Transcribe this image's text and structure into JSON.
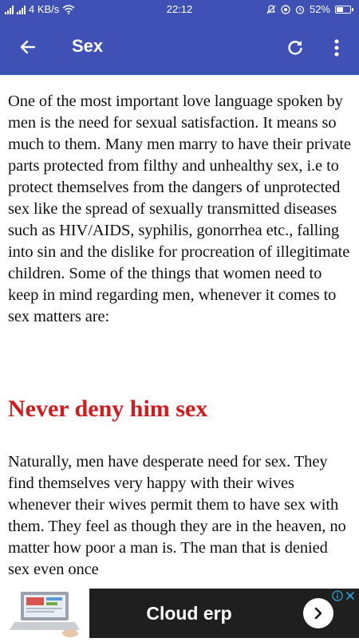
{
  "status_bar": {
    "network_speed": "4 KB/s",
    "time": "22:12",
    "battery_percent": "52%",
    "battery_level": 0.52
  },
  "app_bar": {
    "title": "Sex"
  },
  "article": {
    "paragraph1": "One of the most important love language spoken by men is the need for sexual satisfaction. It means so much to them. Many men marry to have their private parts protected from filthy and unhealthy sex, i.e to protect themselves from the dangers of unprotected sex like the spread of sexually transmitted diseases such as HIV/AIDS, syphilis, gonorrhea etc., falling into sin and the dislike for procreation of illegitimate children. Some of the things that women need to keep in mind regarding men, whenever it comes to sex matters are:",
    "heading": "Never deny him sex",
    "paragraph2": "Naturally, men have desperate need for sex. They find themselves very happy with their wives whenever their wives permit them to have sex with them. They feel as though they are in the heaven, no matter how poor a man is. The man that is denied sex even once"
  },
  "ad": {
    "text": "Cloud erp"
  },
  "colors": {
    "app_bar": "#3f51b5",
    "heading": "#d41a1a",
    "ad_background": "#1f1f1f"
  },
  "icons": [
    "back-arrow-icon",
    "refresh-icon",
    "more-vert-icon",
    "wifi-icon",
    "signal-icon",
    "mute-icon",
    "alarm-icon",
    "battery-icon",
    "chevron-right-icon",
    "info-icon",
    "close-icon"
  ]
}
